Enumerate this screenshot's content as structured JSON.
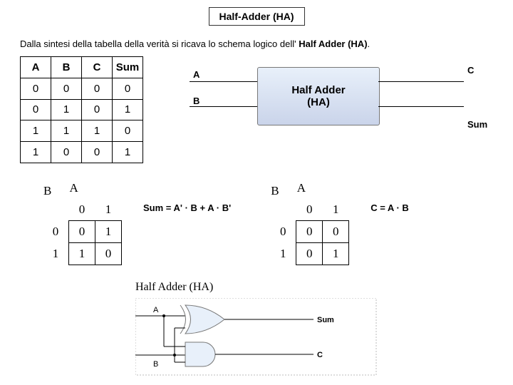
{
  "title": "Half-Adder (HA)",
  "intro_prefix": "Dalla sintesi della tabella della verità  si ricava  lo schema logico dell' ",
  "intro_bold": "Half Adder (HA)",
  "truth": {
    "headers": [
      "A",
      "B",
      "C",
      "Sum"
    ],
    "rows": [
      [
        "0",
        "0",
        "0",
        "0"
      ],
      [
        "0",
        "1",
        "0",
        "1"
      ],
      [
        "1",
        "1",
        "1",
        "0"
      ],
      [
        "1",
        "0",
        "0",
        "1"
      ]
    ]
  },
  "block": {
    "inA": "A",
    "inB": "B",
    "name": "Half Adder\n(HA)",
    "outC": "C",
    "outSum": "Sum"
  },
  "kmap_sum": {
    "row_lbl": "B",
    "col_lbl": "A",
    "cols": [
      "0",
      "1"
    ],
    "rows": [
      "0",
      "1"
    ],
    "cells": [
      [
        "0",
        "1"
      ],
      [
        "1",
        "0"
      ]
    ]
  },
  "kmap_c": {
    "row_lbl": "B",
    "col_lbl": "A",
    "cols": [
      "0",
      "1"
    ],
    "rows": [
      "0",
      "1"
    ],
    "cells": [
      [
        "0",
        "0"
      ],
      [
        "0",
        "1"
      ]
    ]
  },
  "eqn_sum": "Sum = A' · B + A · B'",
  "eqn_c": "C = A · B",
  "circuit_label": "Half Adder (HA)",
  "circuit": {
    "inA": "A",
    "inB": "B",
    "outSum": "Sum",
    "outC": "C"
  }
}
